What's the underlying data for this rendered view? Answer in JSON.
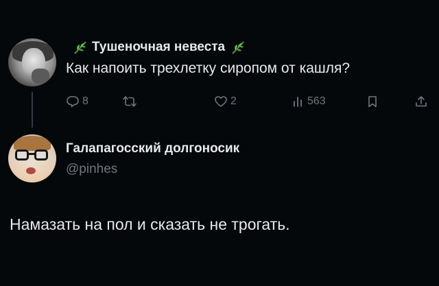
{
  "tweet1": {
    "display_name": "Тушеночная невеста",
    "name_emoji_left": "herb-icon",
    "name_emoji_right": "herb-icon",
    "text": "Как напоить трехлетку сиропом от кашля?",
    "actions": {
      "reply_count": "8",
      "repost_count": "",
      "like_count": "2",
      "views_count": "563"
    }
  },
  "tweet2": {
    "display_name": "Галапагосский долгоносик",
    "handle": "@pinhes",
    "text": "Намазать на пол и сказать не трогать."
  },
  "colors": {
    "background": "#05080b",
    "primary_text": "#e7e9ea",
    "secondary_text": "#71767b",
    "thread_line": "#333a40",
    "emoji_green": "#4c9a3a"
  },
  "icons": {
    "reply": "reply-icon",
    "repost": "repost-icon",
    "like": "heart-icon",
    "views": "views-icon",
    "bookmark": "bookmark-icon",
    "share": "share-icon"
  }
}
